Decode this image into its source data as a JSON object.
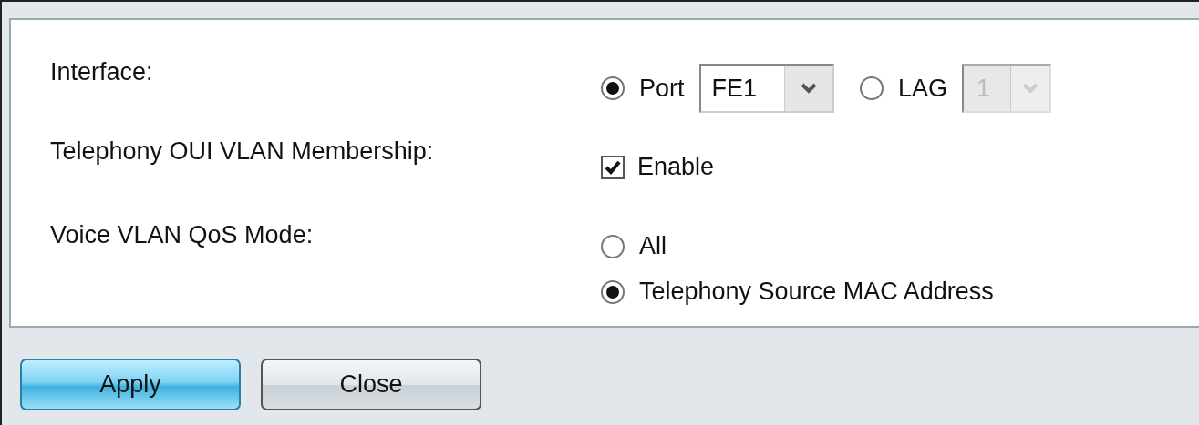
{
  "interface": {
    "label": "Interface:",
    "options": [
      {
        "label": "Port",
        "selected": true,
        "select": {
          "value": "FE1",
          "disabled": false
        }
      },
      {
        "label": "LAG",
        "selected": false,
        "select": {
          "value": "1",
          "disabled": true
        }
      }
    ]
  },
  "membership": {
    "label": "Telephony OUI VLAN Membership:",
    "checkbox": {
      "label": "Enable",
      "checked": true
    }
  },
  "qos_mode": {
    "label": "Voice VLAN QoS Mode:",
    "options": [
      {
        "label": "All",
        "selected": false
      },
      {
        "label": "Telephony Source MAC Address",
        "selected": true
      }
    ]
  },
  "buttons": [
    {
      "label": "Apply",
      "kind": "primary"
    },
    {
      "label": "Close",
      "kind": "secondary"
    }
  ]
}
